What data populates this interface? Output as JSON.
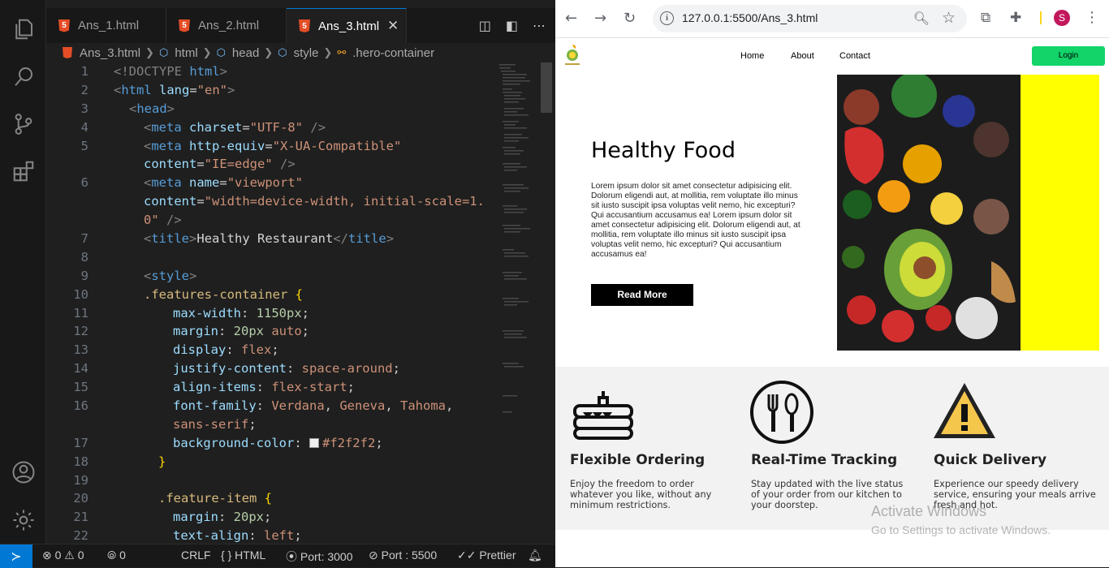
{
  "vscode": {
    "tabs": [
      {
        "label": "Ans_1.html",
        "active": false
      },
      {
        "label": "Ans_2.html",
        "active": false
      },
      {
        "label": "Ans_3.html",
        "active": true
      }
    ],
    "breadcrumb": [
      "Ans_3.html",
      "html",
      "head",
      "style",
      ".hero-container"
    ],
    "line_numbers": [
      "1",
      "2",
      "3",
      "4",
      "5",
      "",
      "6",
      "",
      "7",
      "8",
      "9",
      "10",
      "11",
      "12",
      "13",
      "14",
      "15",
      "16",
      "",
      "17",
      "18",
      "19",
      "20",
      "21",
      "22"
    ],
    "code": {
      "l1_doctype": "<!DOCTYPE",
      "l1_html": " html",
      "l1_end": ">",
      "l2_open": "<",
      "l2_tag": "html",
      "l2_attr": " lang",
      "l2_eq": "=",
      "l2_val": "\"en\"",
      "l2_close": ">",
      "l3_tag": "head",
      "l4_attr": "charset",
      "l4_val": "\"UTF-8\"",
      "l5_attr": "http-equiv",
      "l5_val": "\"X-UA-Compatible\"",
      "l5b_attr": "content",
      "l5b_val": "\"IE=edge\"",
      "l6_attr": "name",
      "l6_val": "\"viewport\"",
      "l6b_attr": "content",
      "l6b_val": "\"width=device-width, initial-scale=1.",
      "l6c_val": "0\"",
      "l7_tag": "title",
      "l7_text": "Healthy Restaurant",
      "l9_tag": "style",
      "l10_sel": ".features-container",
      "l11_prop": "max-width",
      "l11_val": "1150px",
      "l12_prop": "margin",
      "l12_num": "20px",
      "l12_val": " auto",
      "l13_prop": "display",
      "l13_val": "flex",
      "l14_prop": "justify-content",
      "l14_val": "space-around",
      "l15_prop": "align-items",
      "l15_val": "flex-start",
      "l16_prop": "font-family",
      "l16_val1": "Verdana",
      "l16_val2": "Geneva",
      "l16_val3": "Tahoma",
      "l16_val4": "sans-serif",
      "l17_prop": "background-color",
      "l17_val": "#f2f2f2",
      "l20_sel": ".feature-item",
      "l21_prop": "margin",
      "l21_val": "20px",
      "l22_prop": "text-align",
      "l22_val": "left"
    },
    "status": {
      "errors": "0",
      "warnings": "0",
      "ports": "0",
      "eol": "CRLF",
      "language": "HTML",
      "port_3000": "Port: 3000",
      "port_5500": "Port : 5500",
      "prettier": "Prettier"
    }
  },
  "browser": {
    "url": "127.0.0.1:5500/Ans_3.html",
    "avatar_letter": "S",
    "site": {
      "nav": [
        "Home",
        "About",
        "Contact"
      ],
      "login": "Login",
      "hero_title": "Healthy Food",
      "hero_text": "Lorem ipsum dolor sit amet consectetur adipisicing elit. Dolorum eligendi aut, at mollitia, rem voluptate illo minus sit iusto suscipit ipsa voluptas velit nemo, hic excepturi? Qui accusantium accusamus ea! Lorem ipsum dolor sit amet consectetur adipisicing elit. Dolorum eligendi aut, at mollitia, rem voluptate illo minus sit iusto suscipit ipsa voluptas velit nemo, hic excepturi? Qui accusantium accusamus ea!",
      "read_more": "Read More",
      "features": [
        {
          "title": "Flexible Ordering",
          "text": "Enjoy the freedom to order whatever you like, without any minimum restrictions."
        },
        {
          "title": "Real-Time Tracking",
          "text": "Stay updated with the live status of your order from our kitchen to your doorstep."
        },
        {
          "title": "Quick Delivery",
          "text": "Experience our speedy delivery service, ensuring your meals arrive fresh and hot."
        }
      ]
    },
    "watermark": {
      "line1": "Activate Windows",
      "line2": "Go to Settings to activate Windows."
    },
    "colors": {
      "login_green": "#12d469",
      "hero_yellow": "#ffff00",
      "features_bg": "#f2f2f2"
    }
  }
}
